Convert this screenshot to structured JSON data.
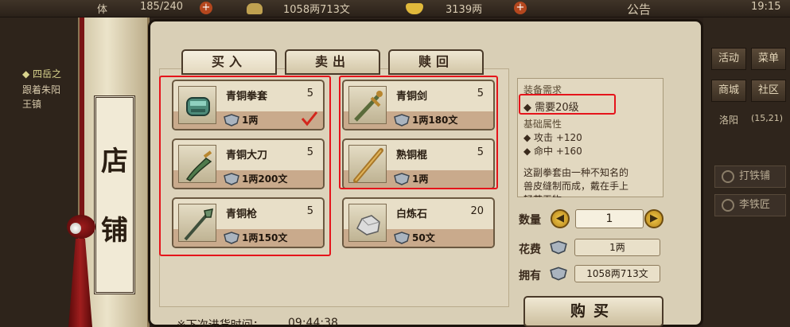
{
  "topbar": {
    "stamina_partial": "体",
    "stamina_value": "185/240",
    "copper_value": "1058两713文",
    "ingot_value": "3139两",
    "notice": "公告",
    "time": "19:15"
  },
  "quest": {
    "title": "◆ 四岳之",
    "line1": "跟着朱阳",
    "line2": "王镇"
  },
  "scroll": {
    "char1": "店",
    "char2": "铺"
  },
  "tabs": [
    {
      "label": "买入"
    },
    {
      "label": "卖出"
    },
    {
      "label": "赎回"
    }
  ],
  "items": [
    {
      "name": "青铜拳套",
      "qty": "5",
      "price": "1两",
      "icon": "gauntlet-icon"
    },
    {
      "name": "青铜剑",
      "qty": "5",
      "price": "1两180文",
      "icon": "sword-icon"
    },
    {
      "name": "青铜大刀",
      "qty": "5",
      "price": "1两200文",
      "icon": "broadsword-icon"
    },
    {
      "name": "熟铜棍",
      "qty": "5",
      "price": "1两",
      "icon": "staff-icon"
    },
    {
      "name": "青铜枪",
      "qty": "5",
      "price": "1两150文",
      "icon": "spear-icon"
    },
    {
      "name": "白炼石",
      "qty": "20",
      "price": "50文",
      "icon": "ore-icon"
    }
  ],
  "detail": {
    "req_header": "装备需求",
    "req_level": "◆ 需要20级",
    "attr_header": "基础属性",
    "attack": "◆ 攻击  +120",
    "hit": "◆ 命中  +160",
    "desc1": "这副拳套由一种不知名的",
    "desc2": "兽皮缝制而成，戴在手上",
    "desc3": "轻若无物"
  },
  "purchase": {
    "qty_label": "数量",
    "qty_value": "1",
    "cost_label": "花费",
    "cost_value": "1两",
    "have_label": "拥有",
    "have_value": "1058两713文",
    "buy_label": "购买",
    "restock_label": "※下次进货时间：",
    "restock_time": "09:44:38"
  },
  "side": {
    "btn_activity": "活动",
    "btn_menu": "菜单",
    "btn_shop": "商城",
    "btn_community": "社区",
    "location": "洛阳",
    "coords": "(15,21)",
    "npc1": "打铁铺",
    "npc2": "李铁匠"
  },
  "colors": {
    "highlight_red": "#e5141b",
    "parchment": "#d9cfb6",
    "price_strip": "#c9aa8c"
  }
}
